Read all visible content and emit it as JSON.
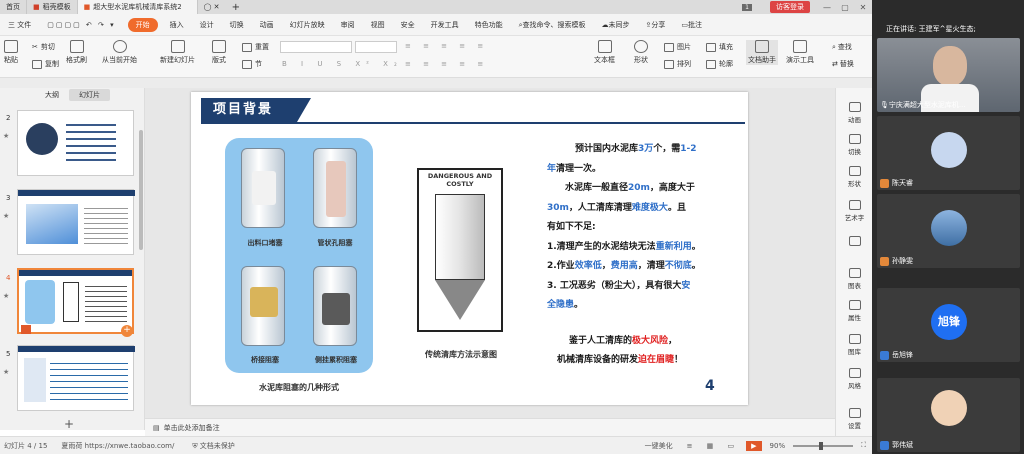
{
  "titlebar": {
    "tabs": [
      "首页",
      "稻壳模板",
      "超大型水泥库机械清库系统2"
    ],
    "page_badge": "1",
    "login": "访客登录",
    "window_controls": [
      "minimize-icon",
      "maximize-icon",
      "close-icon"
    ]
  },
  "menu": {
    "file": "三 文件",
    "start": "开始",
    "items": [
      "插入",
      "设计",
      "切换",
      "动画",
      "幻灯片放映",
      "审阅",
      "视图",
      "安全",
      "开发工具",
      "特色功能"
    ],
    "search": "查找命令、搜索模板",
    "sync": "未同步",
    "share": "分享",
    "comment": "批注"
  },
  "toolbar": {
    "paste": "粘贴",
    "cut": "剪切",
    "copy": "复制",
    "format_painter": "格式刷",
    "play_from_current": "从当前开始",
    "new_slide": "新建幻灯片",
    "layout": "版式",
    "reset": "重置",
    "section": "节",
    "textbox": "文本框",
    "shape": "形状",
    "arrange": "排列",
    "picture": "图片",
    "fill": "填充",
    "outline": "轮廓",
    "doc_helper": "文档助手",
    "presentation_tools": "演示工具",
    "find": "查找",
    "replace": "替换"
  },
  "left_pane": {
    "tab_outline": "大纲",
    "tab_slides": "幻灯片",
    "slides": [
      {
        "num": "2",
        "star": "★"
      },
      {
        "num": "3",
        "star": "★"
      },
      {
        "num": "4",
        "star": "★"
      },
      {
        "num": "5",
        "star": "★"
      }
    ],
    "add": "+"
  },
  "slide": {
    "title": "项目背景",
    "figure_captions": [
      "出料口堵塞",
      "管状孔阻塞",
      "桥接阻塞",
      "侧挂累积阻塞"
    ],
    "left_caption": "水泥库阻塞的几种形式",
    "mid_image_text": "DANGEROUS AND COSTLY",
    "mid_caption": "传统清库方法示意图",
    "para1": [
      {
        "t": "预计国内水泥库",
        "c": "dark"
      },
      {
        "t": "3万",
        "c": "blue"
      },
      {
        "t": "个，需",
        "c": "dark"
      },
      {
        "t": "1-2",
        "c": "blue"
      }
    ],
    "para1b": [
      {
        "t": "年",
        "c": "blue"
      },
      {
        "t": "清理一次。",
        "c": "dark"
      }
    ],
    "para2a": [
      {
        "t": "水泥库一般直径",
        "c": "dark"
      },
      {
        "t": "20m",
        "c": "blue"
      },
      {
        "t": "，高度大于",
        "c": "dark"
      }
    ],
    "para2b": [
      {
        "t": "30m",
        "c": "blue"
      },
      {
        "t": "，人工清库清理",
        "c": "dark"
      },
      {
        "t": "难度极大",
        "c": "blue"
      },
      {
        "t": "。且",
        "c": "dark"
      }
    ],
    "para2c": [
      {
        "t": "有如下不足:",
        "c": "dark"
      }
    ],
    "item1": [
      {
        "t": "1.清理产生的水泥结块无法",
        "c": "dark"
      },
      {
        "t": "重新利用",
        "c": "blue"
      },
      {
        "t": "。",
        "c": "dark"
      }
    ],
    "item2": [
      {
        "t": "2.作业",
        "c": "dark"
      },
      {
        "t": "效率低",
        "c": "blue"
      },
      {
        "t": "，",
        "c": "dark"
      },
      {
        "t": "费用高",
        "c": "blue"
      },
      {
        "t": "，清理",
        "c": "dark"
      },
      {
        "t": "不彻底",
        "c": "blue"
      },
      {
        "t": "。",
        "c": "dark"
      }
    ],
    "item3a": [
      {
        "t": "3. 工况恶劣（粉尘大），具有很大",
        "c": "dark"
      },
      {
        "t": "安",
        "c": "blue"
      }
    ],
    "item3b": [
      {
        "t": "全隐患",
        "c": "blue"
      },
      {
        "t": "。",
        "c": "dark"
      }
    ],
    "concl1": [
      {
        "t": "鉴于人工清库的",
        "c": "dark"
      },
      {
        "t": "极大风险",
        "c": "red"
      },
      {
        "t": "，",
        "c": "dark"
      }
    ],
    "concl2": [
      {
        "t": "机械清库设备的研发",
        "c": "dark"
      },
      {
        "t": "迫在眉睫",
        "c": "red"
      },
      {
        "t": "！",
        "c": "dark"
      }
    ],
    "page_number": "4",
    "colors": {
      "dark": "#1a1a1a",
      "blue": "#2f6fc8",
      "red": "#e02020",
      "title_bar": "#1e3f6f",
      "frame": "#6fb6e6"
    }
  },
  "notes": {
    "placeholder": "单击此处添加备注"
  },
  "right_rail": [
    "动画",
    "切换",
    "形状",
    "艺术字",
    "",
    "图表",
    "属性",
    "图库",
    "风格",
    "设置"
  ],
  "status": {
    "slide_count": "幻灯片 4 / 15",
    "theme": "夏雨荷 https://xnwe.taobao.com/",
    "doc_state": "文档未保护",
    "beautify": "一键美化",
    "zoom": "90%"
  },
  "meeting": {
    "speaking": "正在讲话: 王建军^星火生态;",
    "presenter_label": "宁庆满超大型水泥库机...",
    "participants": [
      {
        "name": "陈天睿"
      },
      {
        "name": "孙静雯"
      },
      {
        "name": "岳旭锋",
        "avatar_text": "旭锋"
      },
      {
        "name": "郭伟斌"
      }
    ]
  }
}
